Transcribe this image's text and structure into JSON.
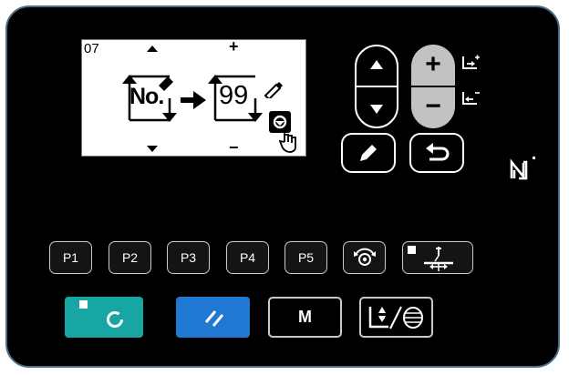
{
  "lcd": {
    "page_number": "07",
    "source_label": "No.",
    "target_value": "99",
    "up_mark": "+",
    "down_mark": "−"
  },
  "nav": {
    "up_arrow": "▲",
    "down_arrow": "▼"
  },
  "adjust": {
    "plus": "+",
    "minus": "−"
  },
  "presets": {
    "p1": "P1",
    "p2": "P2",
    "p3": "P3",
    "p4": "P4",
    "p5": "P5"
  },
  "bottom": {
    "mode_label": "M"
  },
  "colors": {
    "ready_teal": "#18a6a4",
    "reset_blue": "#1f78d1",
    "panel_border": "#4d6f88",
    "adjust_gray": "#c2c2c2"
  },
  "icons": [
    "edit-pencil-icon",
    "return-icon",
    "nfc-icon",
    "thread-tension-icon",
    "presser-foot-icon",
    "ready-circle-icon",
    "reset-slash-icon",
    "winder-icon"
  ]
}
